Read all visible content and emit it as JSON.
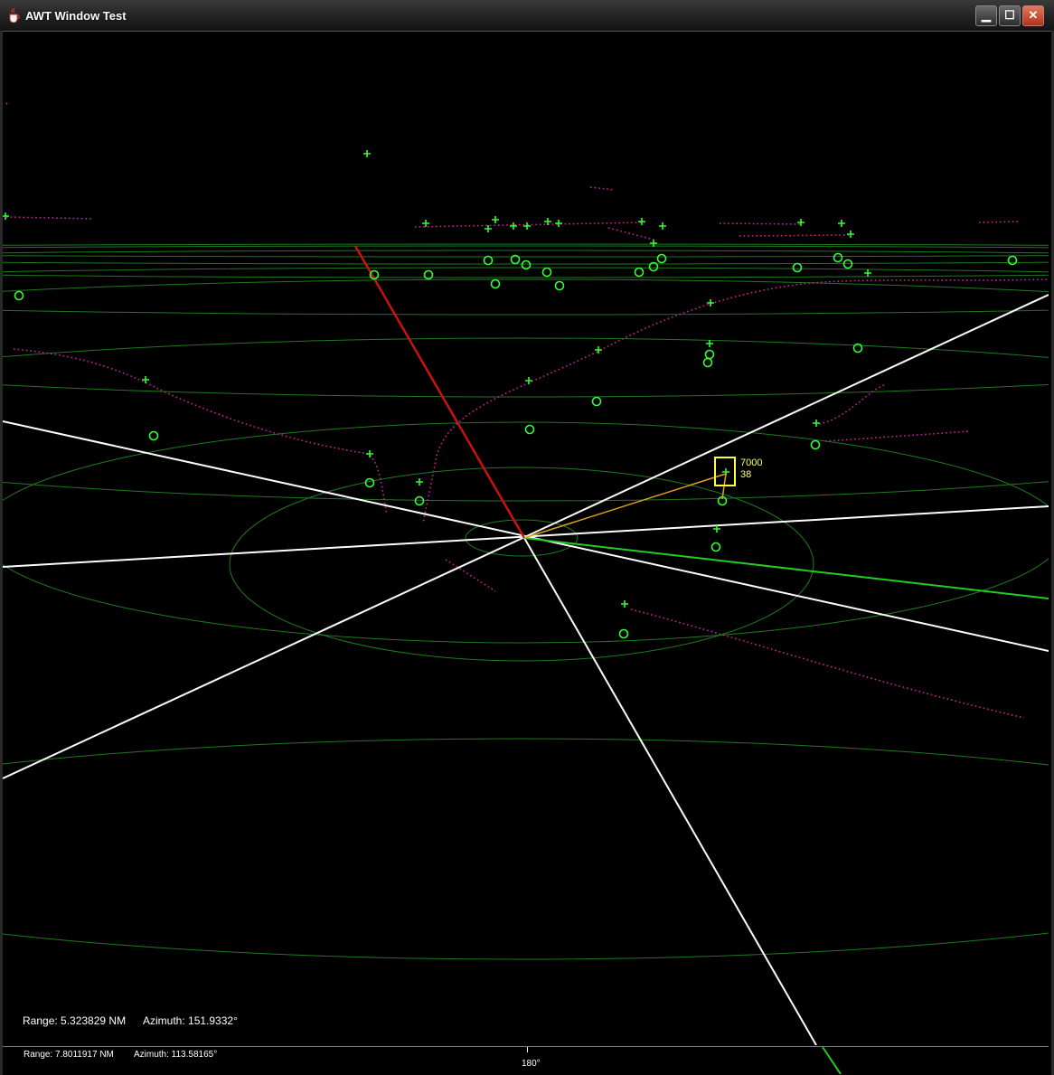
{
  "window": {
    "title": "AWT Window Test",
    "buttons": {
      "minimize": "▁",
      "maximize": "☐",
      "close": "✕"
    }
  },
  "readout": {
    "range": "Range: 5.323829 NM",
    "azimuth": "Azimuth: 151.9332°"
  },
  "status": {
    "range": "Range: 7.8011917 NM",
    "azimuth": "Azimuth: 113.58165°",
    "heading": "180°"
  },
  "selected_track": {
    "altitude": "7000",
    "speed": "38"
  },
  "colors": {
    "background": "#000000",
    "range_rings": "#1f7a1f",
    "axes": "#ffffff",
    "vertical_axis": "#cc1111",
    "heading_line": "#22cc22",
    "track_symbol": "#33ff33",
    "history_trail": "#cc2299",
    "selection": "#ffff33",
    "leader_line": "#e0a020"
  },
  "icons": {
    "app": "java-coffee-icon",
    "minimize": "minimize-icon",
    "maximize": "maximize-icon",
    "close": "close-icon"
  }
}
